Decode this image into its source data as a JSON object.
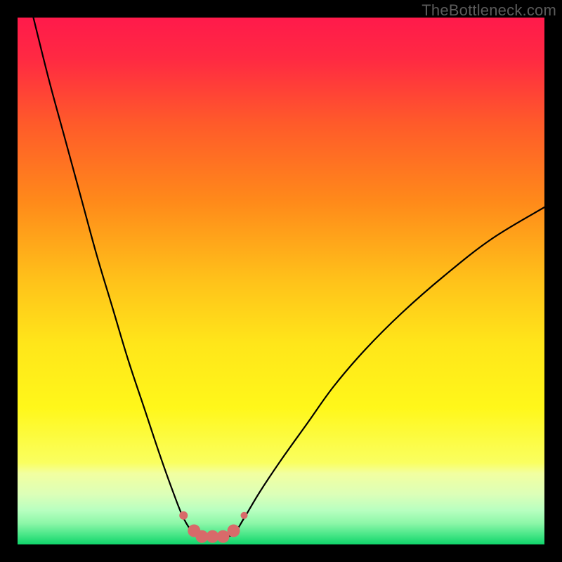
{
  "watermark": "TheBottleneck.com",
  "chart_data": {
    "type": "line",
    "title": "",
    "xlabel": "",
    "ylabel": "",
    "xlim": [
      0,
      100
    ],
    "ylim": [
      0,
      100
    ],
    "grid": false,
    "series": [
      {
        "name": "curve-left",
        "x": [
          3,
          6,
          9,
          12,
          15,
          18,
          21,
          24,
          27,
          29.5,
          31.5,
          33.5
        ],
        "y": [
          100,
          88,
          77,
          66,
          55,
          45,
          35,
          26,
          17,
          10,
          5,
          2
        ]
      },
      {
        "name": "curve-right",
        "x": [
          41,
          43,
          46,
          50,
          55,
          60,
          66,
          73,
          81,
          90,
          100
        ],
        "y": [
          2,
          5,
          10,
          16,
          23,
          30,
          37,
          44,
          51,
          58,
          64
        ]
      }
    ],
    "valley_markers": {
      "x": [
        31.5,
        33.5,
        35,
        37,
        39,
        41,
        43
      ],
      "y": [
        5.5,
        2.6,
        1.5,
        1.5,
        1.5,
        2.6,
        5.5
      ],
      "radius": [
        6,
        9,
        9,
        9,
        9,
        9,
        5
      ]
    },
    "gradient_bands": [
      {
        "offset": 0.0,
        "color": "#ff1a4b"
      },
      {
        "offset": 0.08,
        "color": "#ff2a42"
      },
      {
        "offset": 0.2,
        "color": "#ff5a2a"
      },
      {
        "offset": 0.35,
        "color": "#ff8a1a"
      },
      {
        "offset": 0.5,
        "color": "#ffc21a"
      },
      {
        "offset": 0.62,
        "color": "#ffe61a"
      },
      {
        "offset": 0.74,
        "color": "#fff71a"
      },
      {
        "offset": 0.845,
        "color": "#faff60"
      },
      {
        "offset": 0.865,
        "color": "#f2ffa0"
      },
      {
        "offset": 0.905,
        "color": "#dcffb8"
      },
      {
        "offset": 0.935,
        "color": "#b8ffc0"
      },
      {
        "offset": 0.96,
        "color": "#8cf7a8"
      },
      {
        "offset": 0.98,
        "color": "#4de88a"
      },
      {
        "offset": 1.0,
        "color": "#10d46a"
      }
    ],
    "marker_color": "#d86a6a",
    "curve_color": "#000000"
  }
}
